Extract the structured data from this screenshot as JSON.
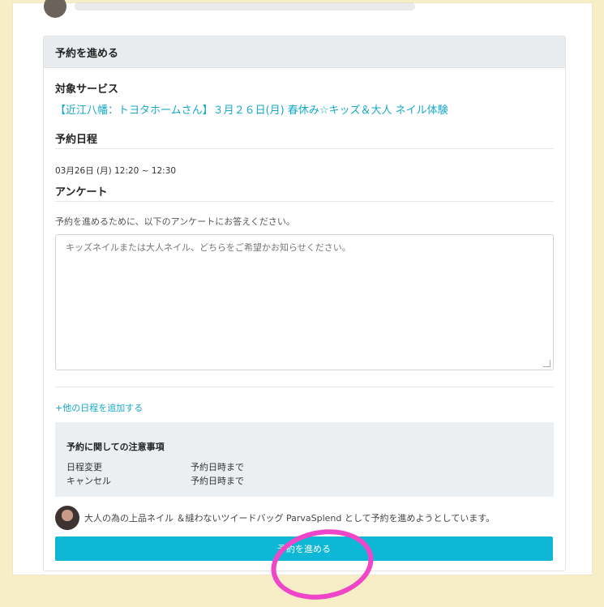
{
  "reservation": {
    "header": "予約を進める",
    "target_service_title": "対象サービス",
    "service_name": "【近江八幡：トヨタホームさん】３月２６日(月) 春休み☆キッズ＆大人 ネイル体験",
    "schedule_title": "予約日程",
    "schedule_value": "03月26日 (月) 12:20 ~ 12:30",
    "survey_title": "アンケート",
    "survey_note": "予約を進めるために、以下のアンケートにお答えください。",
    "survey_placeholder": "キッズネイルまたは大人ネイル、どちらをご希望かお知らせください。",
    "add_schedule": "+他の日程を追加する",
    "notice": {
      "title": "予約に関しての注意事項",
      "rows": [
        {
          "label": "日程変更",
          "value": "予約日時まで"
        },
        {
          "label": "キャンセル",
          "value": "予約日時まで"
        }
      ]
    },
    "user_message": "大人の為の上品ネイル ＆縫わないツイードバッグ ParvaSplend として予約を進めようとしています。",
    "submit_label": "予約を進める"
  },
  "colors": {
    "accent": "#17a9c7",
    "button": "#0fb7d6",
    "background": "#f7eec8",
    "highlight": "#ef46c9"
  }
}
